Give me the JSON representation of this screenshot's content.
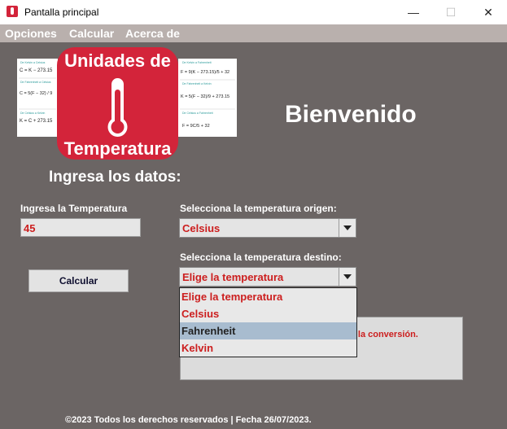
{
  "window": {
    "title": "Pantalla principal",
    "minimize_glyph": "—",
    "maximize_glyph": "☐",
    "close_glyph": "✕"
  },
  "menu": [
    "Opciones",
    "Calcular",
    "Acerca de"
  ],
  "logo": {
    "title_line1": "Unidades de",
    "title_line2": "Temperatura",
    "left_cards": [
      {
        "heading": "De Kelvin a Celsius",
        "formula": "C = K − 273.15"
      },
      {
        "heading": "De Fahrenheit a Celsius",
        "formula": "C = 5(F − 32) / 9"
      },
      {
        "heading": "De Celsius a Kelvin",
        "formula": "K = C + 273.15"
      }
    ],
    "right_cards": [
      {
        "heading": "De Kelvin a Fahrenheit",
        "formula": "F = 9(K − 273.15)/5 + 32"
      },
      {
        "heading": "De Fahrenheit a Kelvin",
        "formula": "K = 5(F − 32)/9 + 273.15"
      },
      {
        "heading": "De Celsius a Fahrenheit",
        "formula": "F = 9C/5 + 32"
      }
    ]
  },
  "welcome": "Bienvenido",
  "form": {
    "heading": "Ingresa los datos:",
    "temp_label": "Ingresa la Temperatura",
    "temp_value": "45",
    "origin_label": "Selecciona la temperatura origen:",
    "origin_value": "Celsius",
    "dest_label": "Selecciona la temperatura destino:",
    "dest_value": "Elige la temperatura",
    "calc_button": "Calcular",
    "result_text": "de la conversión."
  },
  "dropdown_options": [
    "Elige la temperatura",
    "Celsius",
    "Fahrenheit",
    "Kelvin"
  ],
  "footer": "©2023 Todos los derechos reservados | Fecha 26/07/2023.",
  "colors": {
    "accent_red": "#cc1e1e",
    "logo_red": "#d3243a",
    "background": "#6b6564",
    "selected_option": "#a8bccf"
  }
}
